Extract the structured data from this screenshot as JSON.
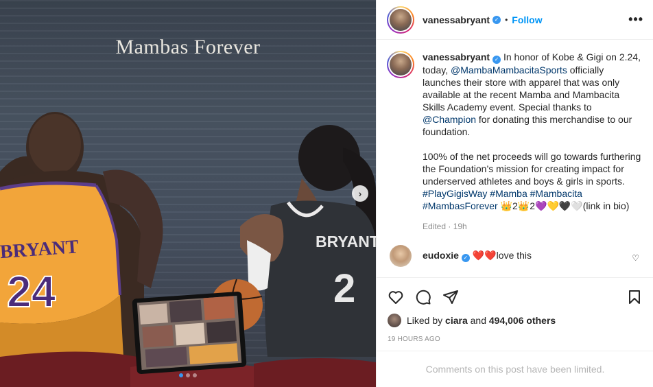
{
  "media": {
    "title_text": "Mambas Forever",
    "jersey_left_name": "BRYANT",
    "jersey_left_number": "24",
    "jersey_right_name": "BRYANT",
    "jersey_right_number": "2",
    "carousel_index": 1,
    "carousel_count": 3
  },
  "header": {
    "username": "vanessabryant",
    "separator": "•",
    "follow_label": "Follow",
    "more_label": "•••"
  },
  "caption": {
    "username": "vanessabryant",
    "p1_a": "In honor of Kobe & Gigi on 2.24, today,",
    "mention_1": "@MambaMambacitaSports",
    "p1_b": "officially launches their store with apparel that was only available at the recent Mamba and Mambacita Skills Academy event. Special thanks to",
    "mention_2": "@Champion",
    "p1_c": "for donating this merchandise to our foundation.",
    "p2_a": "100% of the net proceeds will go towards furthering the Foundation’s mission for creating impact for underserved athletes and boys & girls in sports.",
    "hashtags": "#PlayGigisWay #Mamba #Mambacita #MambasForever",
    "emojis": "👑2👑2💜💛🖤🤍",
    "p2_end": "(link in bio)",
    "edited": "Edited · 19h"
  },
  "reply": {
    "username": "eudoxie",
    "hearts": "❤️❤️",
    "text": "love this"
  },
  "likes": {
    "prefix": "Liked by",
    "user": "ciara",
    "conj": "and",
    "count": "494,006 others"
  },
  "timestamp": "19 HOURS AGO",
  "comments_limited": "Comments on this post have been limited.",
  "colors": {
    "accent": "#0095f6",
    "link": "#00376b",
    "verified": "#3897f0",
    "lakers_gold": "#f2a53a",
    "jersey_dark": "#2f3237"
  }
}
